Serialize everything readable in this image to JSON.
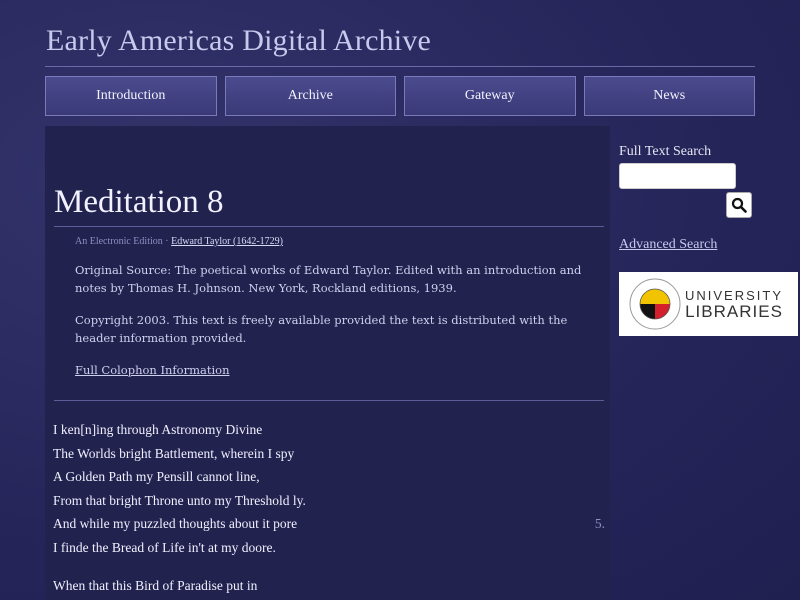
{
  "site": {
    "title": "Early Americas Digital Archive"
  },
  "nav": [
    {
      "label": "Introduction"
    },
    {
      "label": "Archive"
    },
    {
      "label": "Gateway"
    },
    {
      "label": "News"
    }
  ],
  "page": {
    "title": "Meditation 8",
    "edition": "An Electronic Edition",
    "separator": "·",
    "author_link": "Edward Taylor (1642-1729)",
    "source": "Original Source: The poetical works of Edward Taylor. Edited with an introduction and notes by Thomas H. Johnson. New York, Rockland editions, 1939.",
    "copyright": "Copyright 2003. This text is freely available provided the text is distributed with the header information provided.",
    "colophon_link": "Full Colophon Information"
  },
  "poem": {
    "stanza1": [
      "I ken[n]ing through Astronomy Divine",
      "The Worlds bright Battlement, wherein I spy",
      "A Golden Path my Pensill cannot line,",
      "From that bright Throne unto my Threshold ly.",
      "And while my puzzled thoughts about it pore",
      "I finde the Bread of Life in't at my doore."
    ],
    "line_number": "5.",
    "stanza2": [
      "When that this Bird of Paradise put in"
    ]
  },
  "sidebar": {
    "search_label": "Full Text Search",
    "search_value": "",
    "advanced_search": "Advanced Search",
    "logo": {
      "line1": "UNIVERSITY",
      "line2": "LIBRARIES"
    }
  },
  "colors": {
    "background": "#2a2a5e",
    "panel": "#22224f",
    "nav": "#44448a"
  }
}
